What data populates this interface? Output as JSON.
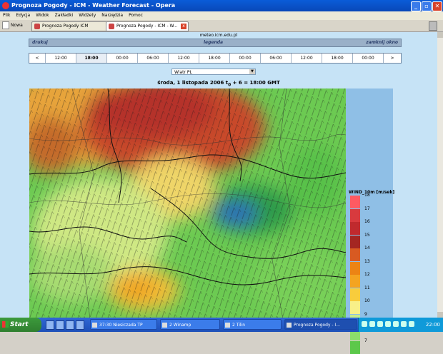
{
  "window": {
    "title": "Prognoza Pogody - ICM - Weather Forecast - Opera"
  },
  "menu": [
    "Plik",
    "Edycja",
    "Widok",
    "Zakładki",
    "Widżety",
    "Narzędzia",
    "Pomoc"
  ],
  "toolbar": {
    "new_label": "Nowa"
  },
  "tabs": [
    {
      "label": "Prognoza Pogody ICM"
    },
    {
      "label": "Prognoza Pogody - ICM - W..."
    }
  ],
  "page": {
    "url": "meteo.icm.edu.pl",
    "links": {
      "print": "drukuj",
      "legend": "legenda",
      "close": "zamknij okno"
    },
    "nav_prev": "<",
    "nav_next": ">",
    "times": [
      "12:00",
      "18:00",
      "00:00",
      "06:00",
      "12:00",
      "18:00",
      "00:00",
      "06:00",
      "12:00",
      "18:00",
      "00:00"
    ],
    "selected_time_index": 1,
    "layer_select": "Wiatr PL",
    "date_line": "środa, 1 listopada 2006 t",
    "date_sub": "0",
    "date_rest": " + 6 = 18:00 GMT",
    "legend_title": "WIND_10m [m/sek]",
    "legend": [
      {
        "value": "18",
        "color": "#ff5a62"
      },
      {
        "value": "17",
        "color": "#d83a3e"
      },
      {
        "value": "16",
        "color": "#c02a2e"
      },
      {
        "value": "15",
        "color": "#a42622"
      },
      {
        "value": "14",
        "color": "#d85a22"
      },
      {
        "value": "13",
        "color": "#ec8414"
      },
      {
        "value": "12",
        "color": "#f4a420"
      },
      {
        "value": "11",
        "color": "#f8cc3c"
      },
      {
        "value": "10",
        "color": "#f8f088"
      },
      {
        "value": "9",
        "color": "#c8ec8c"
      },
      {
        "value": "8",
        "color": "#8cde6a"
      },
      {
        "value": "7",
        "color": "#5cc84a"
      }
    ]
  },
  "taskbar": {
    "start": "Start",
    "tasks": [
      {
        "label": "37:30 Niesiczada TP"
      },
      {
        "label": "2 Winamp"
      },
      {
        "label": "2 Tilin"
      },
      {
        "label": "Prognoza Pogody - I..."
      }
    ],
    "clock": "22:00"
  }
}
